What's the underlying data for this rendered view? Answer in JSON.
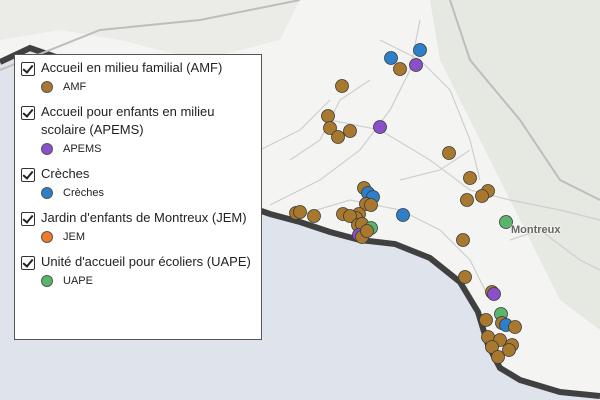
{
  "map": {
    "city_label": "Montreux",
    "colors": {
      "land": "#f4f4f3",
      "lake": "#dfe4ec",
      "forest": "#e3e6de",
      "roads": "#d2d2d2",
      "shore": "#404040"
    }
  },
  "legend": {
    "layers": [
      {
        "title": "Accueil en milieu familial (AMF)",
        "item_label": "AMF",
        "color": "#a7782e",
        "checked": true
      },
      {
        "title": "Accueil pour enfants en milieu scolaire (APEMS)",
        "item_label": "APEMS",
        "color": "#8b4fc9",
        "checked": true
      },
      {
        "title": "Crèches",
        "item_label": "Crèches",
        "color": "#2e7fc9",
        "checked": true
      },
      {
        "title": "Jardin d'enfants de Montreux (JEM)",
        "item_label": "JEM",
        "color": "#f07a2a",
        "checked": true
      },
      {
        "title": "Unité d'accueil pour écoliers (UAPE)",
        "item_label": "UAPE",
        "color": "#5ab56c",
        "checked": true
      }
    ]
  }
}
